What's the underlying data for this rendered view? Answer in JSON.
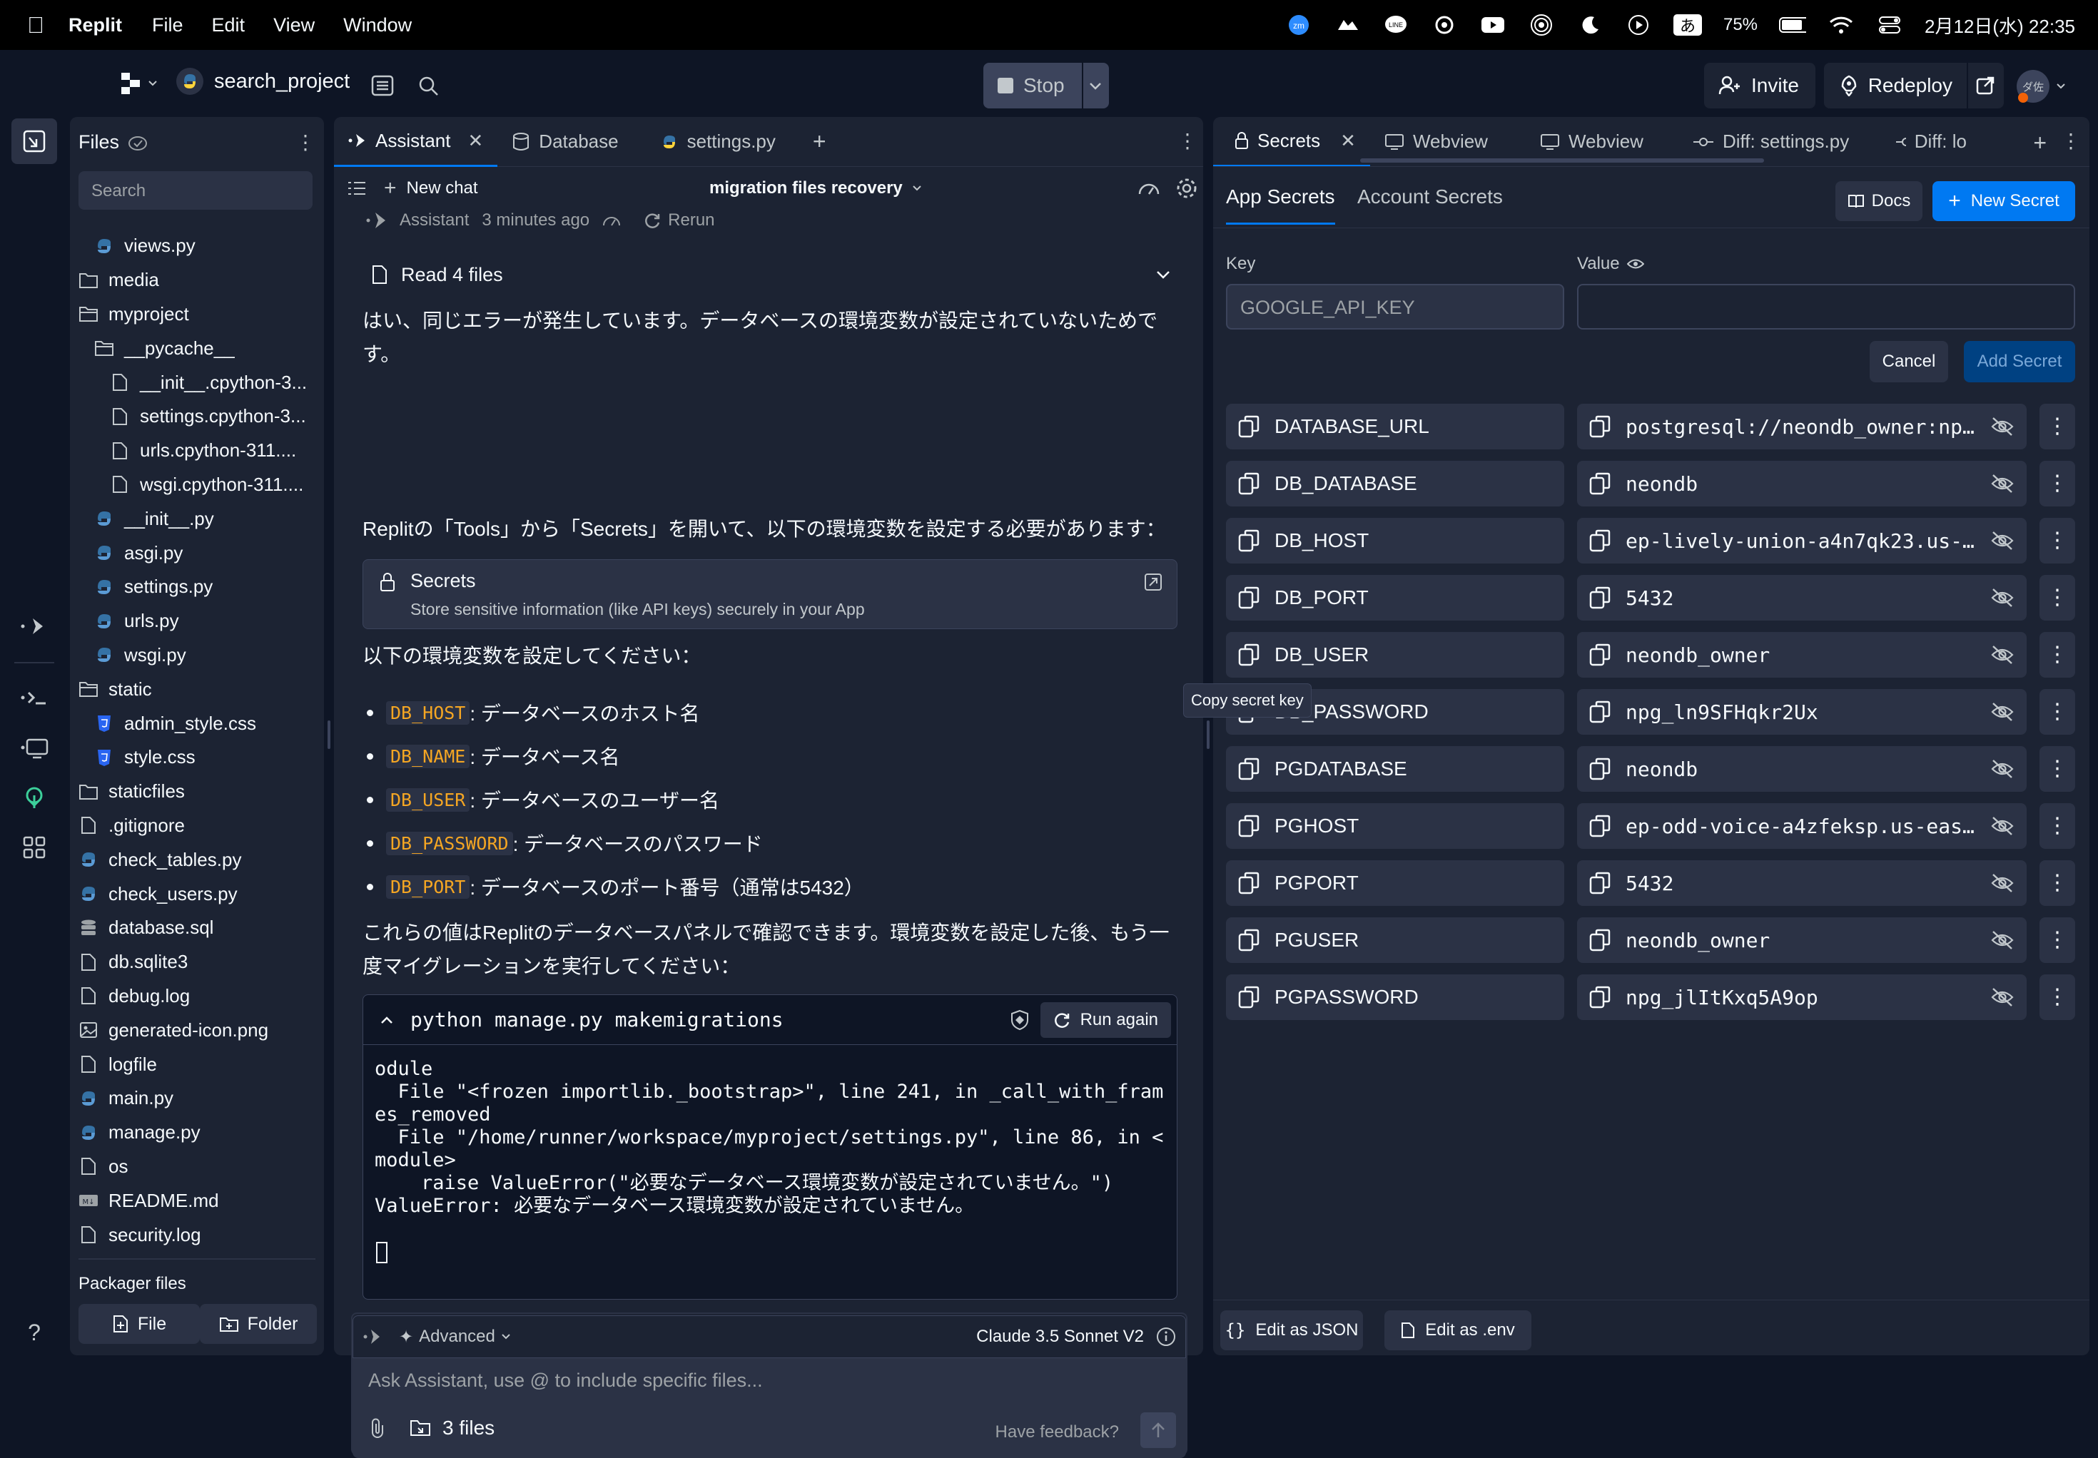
{
  "menubar": {
    "app": "Replit",
    "items": [
      "File",
      "Edit",
      "View",
      "Window"
    ],
    "battery": "75%",
    "ime": "あ",
    "datetime": "2月12日(水) 22:35"
  },
  "topbar": {
    "project": "search_project",
    "stop": "Stop",
    "invite": "Invite",
    "redeploy": "Redeploy",
    "avatar": "ダ佐"
  },
  "files": {
    "title": "Files",
    "search_placeholder": "Search",
    "packager_title": "Packager files",
    "file_btn": "File",
    "folder_btn": "Folder",
    "rows": [
      {
        "label": "views.py",
        "icon": "python",
        "indent": 1
      },
      {
        "label": "media",
        "icon": "folder",
        "indent": 0
      },
      {
        "label": "myproject",
        "icon": "folder-open",
        "indent": 0
      },
      {
        "label": "__pycache__",
        "icon": "folder-open",
        "indent": 1
      },
      {
        "label": "__init__.cpython-3...",
        "icon": "file",
        "indent": 2
      },
      {
        "label": "settings.cpython-3...",
        "icon": "file",
        "indent": 2
      },
      {
        "label": "urls.cpython-311....",
        "icon": "file",
        "indent": 2
      },
      {
        "label": "wsgi.cpython-311....",
        "icon": "file",
        "indent": 2
      },
      {
        "label": "__init__.py",
        "icon": "python",
        "indent": 1
      },
      {
        "label": "asgi.py",
        "icon": "python",
        "indent": 1
      },
      {
        "label": "settings.py",
        "icon": "python",
        "indent": 1
      },
      {
        "label": "urls.py",
        "icon": "python",
        "indent": 1
      },
      {
        "label": "wsgi.py",
        "icon": "python",
        "indent": 1
      },
      {
        "label": "static",
        "icon": "folder-open",
        "indent": 0
      },
      {
        "label": "admin_style.css",
        "icon": "css",
        "indent": 1
      },
      {
        "label": "style.css",
        "icon": "css",
        "indent": 1
      },
      {
        "label": "staticfiles",
        "icon": "folder",
        "indent": 0
      },
      {
        "label": ".gitignore",
        "icon": "file",
        "indent": 0
      },
      {
        "label": "check_tables.py",
        "icon": "python",
        "indent": 0
      },
      {
        "label": "check_users.py",
        "icon": "python",
        "indent": 0
      },
      {
        "label": "database.sql",
        "icon": "db",
        "indent": 0
      },
      {
        "label": "db.sqlite3",
        "icon": "file",
        "indent": 0
      },
      {
        "label": "debug.log",
        "icon": "file",
        "indent": 0
      },
      {
        "label": "generated-icon.png",
        "icon": "image",
        "indent": 0
      },
      {
        "label": "logfile",
        "icon": "file",
        "indent": 0
      },
      {
        "label": "main.py",
        "icon": "python",
        "indent": 0
      },
      {
        "label": "manage.py",
        "icon": "python",
        "indent": 0
      },
      {
        "label": "os",
        "icon": "file",
        "indent": 0
      },
      {
        "label": "README.md",
        "icon": "md",
        "indent": 0
      },
      {
        "label": "security.log",
        "icon": "file",
        "indent": 0
      }
    ]
  },
  "assistant_tabs": [
    {
      "label": "Assistant",
      "active": true
    },
    {
      "label": "Database"
    },
    {
      "label": "settings.py"
    }
  ],
  "assistant": {
    "new_chat": "New chat",
    "chat_title": "migration files recovery",
    "meta_name": "Assistant",
    "meta_time": "3 minutes ago",
    "rerun": "Rerun",
    "read_files": "Read 4 files",
    "p1": "はい、同じエラーが発生しています。データベースの環境変数が設定されていないためです。",
    "p2": "Replitの「Tools」から「Secrets」を開いて、以下の環境変数を設定する必要があります：",
    "secrets_card_title": "Secrets",
    "secrets_card_desc": "Store sensitive information (like API keys) securely in your App",
    "p3": "以下の環境変数を設定してください：",
    "bullets": [
      {
        "code": "DB_HOST",
        "text": ": データベースのホスト名"
      },
      {
        "code": "DB_NAME",
        "text": ": データベース名"
      },
      {
        "code": "DB_USER",
        "text": ": データベースのユーザー名"
      },
      {
        "code": "DB_PASSWORD",
        "text": ": データベースのパスワード"
      },
      {
        "code": "DB_PORT",
        "text": ": データベースのポート番号（通常は5432）"
      }
    ],
    "p4": "これらの値はReplitのデータベースパネルで確認できます。環境変数を設定した後、もう一度マイグレーションを実行してください：",
    "cmd": "python manage.py makemigrations",
    "run_again": "Run again",
    "terminal": "odule\n  File \"<frozen importlib._bootstrap>\", line 241, in _call_with_frames_removed\n  File \"/home/runner/workspace/myproject/settings.py\", line 86, in <module>\n    raise ValueError(\"必要なデータベース環境変数が設定されていません。\")\nValueError: 必要なデータベース環境変数が設定されていません。",
    "advanced": "Advanced",
    "model": "Claude 3.5 Sonnet V2",
    "input_placeholder": "Ask Assistant, use @ to include specific files...",
    "files_count": "3 files",
    "feedback": "Have feedback?"
  },
  "secrets_tabs": [
    {
      "label": "Secrets",
      "active": true
    },
    {
      "label": "Webview"
    },
    {
      "label": "Webview"
    },
    {
      "label": "Diff: settings.py"
    },
    {
      "label": "Diff: lo"
    }
  ],
  "secrets": {
    "app_tab": "App Secrets",
    "account_tab": "Account Secrets",
    "docs": "Docs",
    "new_secret": "New Secret",
    "key_label": "Key",
    "value_label": "Value",
    "key_placeholder": "GOOGLE_API_KEY",
    "cancel": "Cancel",
    "add_secret": "Add Secret",
    "tooltip": "Copy secret key",
    "items": [
      {
        "key": "DATABASE_URL",
        "value": "postgresql://neondb_owner:npg…"
      },
      {
        "key": "DB_DATABASE",
        "value": "neondb"
      },
      {
        "key": "DB_HOST",
        "value": "ep-lively-union-a4n7qk23.us-e…"
      },
      {
        "key": "DB_PORT",
        "value": "5432"
      },
      {
        "key": "DB_USER",
        "value": "neondb_owner"
      },
      {
        "key": "DB_PASSWORD",
        "value": "npg_ln9SFHqkr2Ux"
      },
      {
        "key": "PGDATABASE",
        "value": "neondb"
      },
      {
        "key": "PGHOST",
        "value": "ep-odd-voice-a4zfeksp.us-east…"
      },
      {
        "key": "PGPORT",
        "value": "5432"
      },
      {
        "key": "PGUSER",
        "value": "neondb_owner"
      },
      {
        "key": "PGPASSWORD",
        "value": "npg_jlItKxq5A9op"
      }
    ],
    "edit_json": "Edit as JSON",
    "edit_env": "Edit as .env"
  },
  "colors": {
    "bg": "#0e1525",
    "panel": "#1c2333",
    "field": "#2b3245",
    "accent": "#0079f2",
    "code": "#f5a623",
    "python": "#3572A5",
    "css": "#2965f1"
  }
}
